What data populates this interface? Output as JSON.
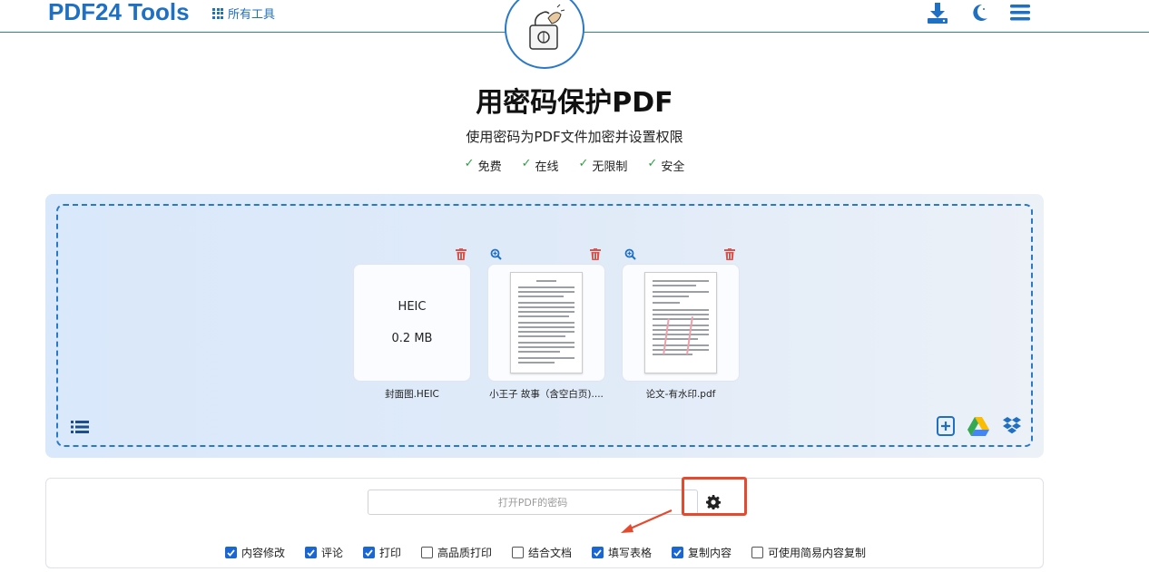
{
  "header": {
    "logo": "PDF24 Tools",
    "all_tools": "所有工具"
  },
  "hero": {
    "title": "用密码保护PDF",
    "subtitle": "使用密码为PDF文件加密并设置权限",
    "features": [
      {
        "check": "✓",
        "label": "免费"
      },
      {
        "check": "✓",
        "label": "在线"
      },
      {
        "check": "✓",
        "label": "无限制"
      },
      {
        "check": "✓",
        "label": "安全"
      }
    ]
  },
  "files": [
    {
      "name": "封面图.HEIC",
      "type": "HEIC",
      "size": "0.2 MB"
    },
    {
      "name": "小王子 故事（含空白页)...."
    },
    {
      "name": "论文-有水印.pdf"
    }
  ],
  "options": {
    "password_placeholder": "打开PDF的密码",
    "permissions": [
      {
        "label": "内容修改",
        "checked": true
      },
      {
        "label": "评论",
        "checked": true
      },
      {
        "label": "打印",
        "checked": true
      },
      {
        "label": "高品质打印",
        "checked": false
      },
      {
        "label": "结合文档",
        "checked": false
      },
      {
        "label": "填写表格",
        "checked": true
      },
      {
        "label": "复制内容",
        "checked": true
      },
      {
        "label": "可使用简易内容复制",
        "checked": false
      }
    ]
  },
  "colors": {
    "brand": "#1f6fc2",
    "check_green": "#2f9e44",
    "trash_red": "#d9534f",
    "checkbox_blue": "#1a66d2",
    "annotation_red": "#e64a2e"
  }
}
